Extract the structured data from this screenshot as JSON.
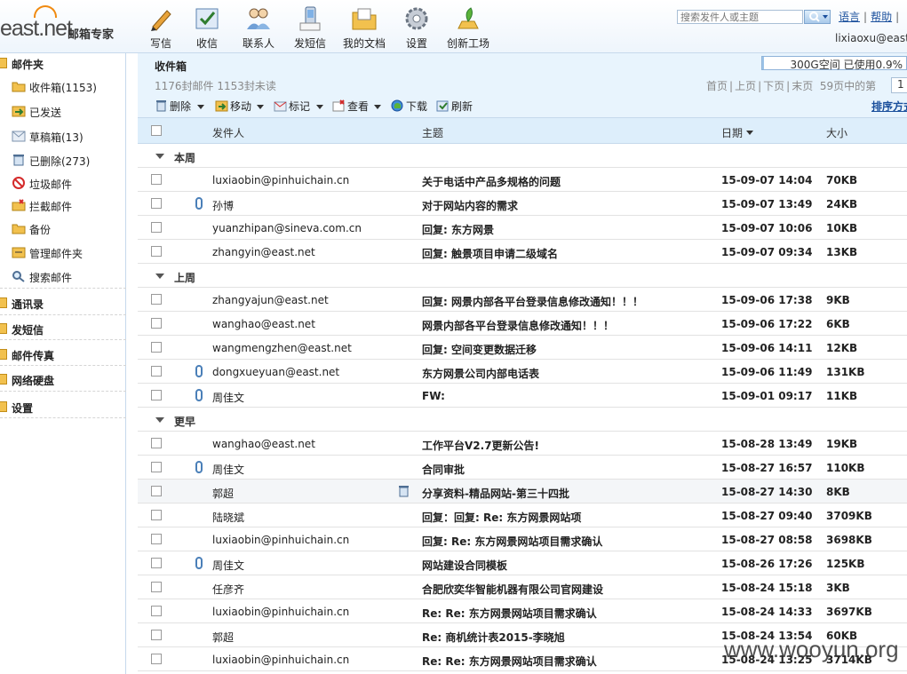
{
  "logo": {
    "text": "east.net",
    "sub": "邮箱专家"
  },
  "toolbar": [
    {
      "label": "写信",
      "icon": "pen-icon"
    },
    {
      "label": "收信",
      "icon": "inbox-check-icon"
    },
    {
      "label": "联系人",
      "icon": "contacts-icon"
    },
    {
      "label": "发短信",
      "icon": "phone-icon"
    },
    {
      "label": "我的文档",
      "icon": "folder-docs-icon"
    },
    {
      "label": "设置",
      "icon": "gear-icon"
    },
    {
      "label": "创新工场",
      "icon": "sprout-icon"
    }
  ],
  "search": {
    "placeholder": "搜索发件人或主题"
  },
  "top_links": {
    "language": "语言",
    "help": "帮助",
    "sep": "|"
  },
  "user": {
    "name": "lixiaoxu@east"
  },
  "sidebar": {
    "mail_folder_head": "邮件夹",
    "folders": [
      {
        "label": "收件箱(1153)",
        "icon": "inbox-icon"
      },
      {
        "label": "已发送",
        "icon": "sent-icon"
      },
      {
        "label": "草稿箱(13)",
        "icon": "draft-icon"
      },
      {
        "label": "已删除(273)",
        "icon": "trash-icon"
      },
      {
        "label": "垃圾邮件",
        "icon": "spam-icon"
      },
      {
        "label": "拦截邮件",
        "icon": "blocked-icon"
      },
      {
        "label": "备份",
        "icon": "backup-folder-icon"
      },
      {
        "label": "管理邮件夹",
        "icon": "manage-folder-icon"
      },
      {
        "label": "搜索邮件",
        "icon": "search-icon"
      }
    ],
    "sections": [
      {
        "label": "通讯录"
      },
      {
        "label": "发短信"
      },
      {
        "label": "邮件传真"
      },
      {
        "label": "网络硬盘"
      },
      {
        "label": "设置"
      }
    ]
  },
  "main": {
    "folder_title": "收件箱",
    "mail_count": "1176封邮件 1153封未读",
    "quota": {
      "text": "300G空间 已使用0.9%",
      "used_percent": 0.9
    },
    "pager": {
      "first": "首页",
      "prev": "上页",
      "next": "下页",
      "last": "末页",
      "sep": "|",
      "total": "59页中的第",
      "current": "1"
    },
    "actions": [
      {
        "label": "删除",
        "icon": "delete-icon",
        "dropdown": true
      },
      {
        "label": "移动",
        "icon": "move-icon",
        "dropdown": true
      },
      {
        "label": "标记",
        "icon": "flag-icon",
        "dropdown": true
      },
      {
        "label": "查看",
        "icon": "view-icon",
        "dropdown": true
      },
      {
        "label": "下载",
        "icon": "download-icon",
        "dropdown": false
      },
      {
        "label": "刷新",
        "icon": "refresh-icon",
        "dropdown": false
      }
    ],
    "sort_link": "排序方式",
    "columns": {
      "sender": "发件人",
      "subject": "主题",
      "date": "日期",
      "size": "大小"
    },
    "groups": [
      {
        "label": "本周",
        "rows": [
          {
            "sender": "luxiaobin@pinhuichain.cn",
            "subject": "关于电话中产品多规格的问题",
            "date": "15-09-07 14:04",
            "size": "70KB",
            "attach": false
          },
          {
            "sender": "孙博",
            "subject": "对于网站内容的需求",
            "date": "15-09-07 13:49",
            "size": "24KB",
            "attach": true
          },
          {
            "sender": "yuanzhipan@sineva.com.cn",
            "subject": "回复: 东方网景",
            "date": "15-09-07 10:06",
            "size": "10KB",
            "attach": false
          },
          {
            "sender": "zhangyin@east.net",
            "subject": "回复: 触景项目申请二级域名",
            "date": "15-09-07 09:34",
            "size": "13KB",
            "attach": false
          }
        ]
      },
      {
        "label": "上周",
        "rows": [
          {
            "sender": "zhangyajun@east.net",
            "subject": "回复: 网景内部各平台登录信息修改通知！！！",
            "date": "15-09-06 17:38",
            "size": "9KB",
            "attach": false
          },
          {
            "sender": "wanghao@east.net",
            "subject": "网景内部各平台登录信息修改通知！！！",
            "date": "15-09-06 17:22",
            "size": "6KB",
            "attach": false
          },
          {
            "sender": "wangmengzhen@east.net",
            "subject": "回复: 空间变更数据迁移",
            "date": "15-09-06 14:11",
            "size": "12KB",
            "attach": false
          },
          {
            "sender": "dongxueyuan@east.net",
            "subject": "东方网景公司内部电话表",
            "date": "15-09-06 11:49",
            "size": "131KB",
            "attach": true
          },
          {
            "sender": "周佳文",
            "subject": "FW:",
            "date": "15-09-01 09:17",
            "size": "11KB",
            "attach": true
          }
        ]
      },
      {
        "label": "更早",
        "rows": [
          {
            "sender": "wanghao@east.net",
            "subject": "工作平台V2.7更新公告!",
            "date": "15-08-28 13:49",
            "size": "19KB",
            "attach": false
          },
          {
            "sender": "周佳文",
            "subject": "合同审批",
            "date": "15-08-27 16:57",
            "size": "110KB",
            "attach": true
          },
          {
            "sender": "郭超",
            "subject": "分享资料-精品网站-第三十四批",
            "date": "15-08-27 14:30",
            "size": "8KB",
            "attach": false,
            "trash": true,
            "alt": true
          },
          {
            "sender": "陆晓斌",
            "subject": "回复：回复: Re: 东方网景网站项",
            "date": "15-08-27 09:40",
            "size": "3709KB",
            "attach": false
          },
          {
            "sender": "luxiaobin@pinhuichain.cn",
            "subject": "回复: Re: 东方网景网站项目需求确认",
            "date": "15-08-27 08:58",
            "size": "3698KB",
            "attach": false
          },
          {
            "sender": "周佳文",
            "subject": "网站建设合同模板",
            "date": "15-08-26 17:26",
            "size": "125KB",
            "attach": true
          },
          {
            "sender": "任彦齐",
            "subject": "合肥欣奕华智能机器有限公司官网建设",
            "date": "15-08-24 15:18",
            "size": "3KB",
            "attach": false
          },
          {
            "sender": "luxiaobin@pinhuichain.cn",
            "subject": "Re: Re: 东方网景网站项目需求确认",
            "date": "15-08-24 14:33",
            "size": "3697KB",
            "attach": false
          },
          {
            "sender": "郭超",
            "subject": "Re: 商机统计表2015-李晓旭",
            "date": "15-08-24 13:54",
            "size": "60KB",
            "attach": false
          },
          {
            "sender": "luxiaobin@pinhuichain.cn",
            "subject": "Re: Re: 东方网景网站项目需求确认",
            "date": "15-08-24 13:25",
            "size": "3714KB",
            "attach": false
          }
        ]
      }
    ]
  },
  "watermark": "www.wooyun.org",
  "colors": {
    "accent": "#1a4f9c",
    "header_bg": "#e8f4fd",
    "column_header_bg": "#ddeefb",
    "logo_orange": "#f08a10"
  }
}
